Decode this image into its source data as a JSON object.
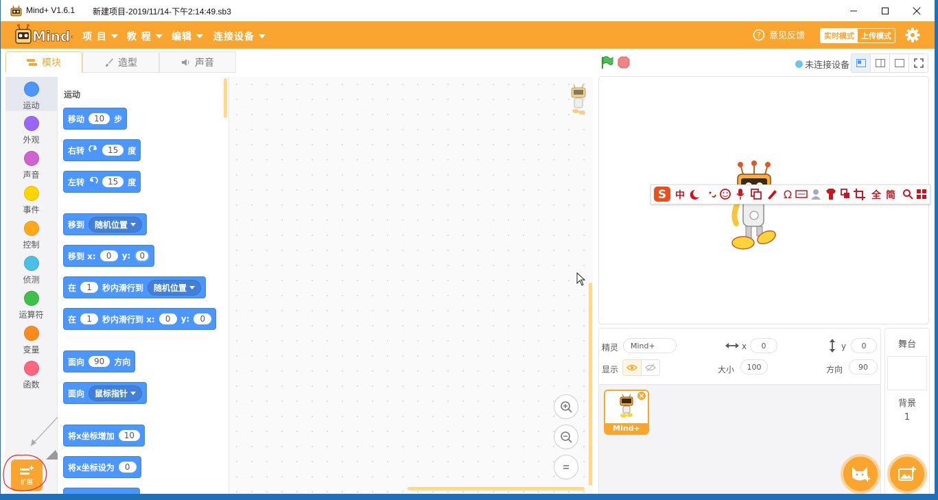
{
  "window": {
    "app_title": "Mind+ V1.6.1",
    "file_name": "新建项目-2019/11/14-下午2:14:49.sb3"
  },
  "menu": {
    "items": [
      {
        "label": "项 目"
      },
      {
        "label": "教 程"
      },
      {
        "label": "编辑"
      },
      {
        "label": "连接设备"
      }
    ],
    "feedback": "意见反馈",
    "mode_realtime": "实时模式",
    "mode_upload": "上传模式"
  },
  "tabs": [
    {
      "label": "模块"
    },
    {
      "label": "造型"
    },
    {
      "label": "声音"
    }
  ],
  "categories": [
    {
      "label": "运动",
      "color": "#4c97ff"
    },
    {
      "label": "外观",
      "color": "#9966ff"
    },
    {
      "label": "声音",
      "color": "#cf63cf"
    },
    {
      "label": "事件",
      "color": "#ffd500"
    },
    {
      "label": "控制",
      "color": "#ffab19"
    },
    {
      "label": "侦测",
      "color": "#4cbfe6"
    },
    {
      "label": "运算符",
      "color": "#40bf4a"
    },
    {
      "label": "变量",
      "color": "#ff8c1a"
    },
    {
      "label": "函数",
      "color": "#ff6680"
    }
  ],
  "extension_label": "扩展",
  "palette": {
    "section": "运动",
    "b1": {
      "a": "移动",
      "v": "10",
      "b": "步"
    },
    "b2": {
      "a": "右转",
      "v": "15",
      "b": "度"
    },
    "b3": {
      "a": "左转",
      "v": "15",
      "b": "度"
    },
    "b4": {
      "a": "移到",
      "dd": "随机位置"
    },
    "b5": {
      "a": "移到 x:",
      "x": "0",
      "y_label": "y:",
      "y": "0"
    },
    "b6": {
      "a": "在",
      "v": "1",
      "b": "秒内滑行到",
      "dd": "随机位置"
    },
    "b7": {
      "a": "在",
      "v": "1",
      "b": "秒内滑行到 x:",
      "x": "0",
      "y_label": "y:",
      "y": "0"
    },
    "b8": {
      "a": "面向",
      "v": "90",
      "b": "方向"
    },
    "b9": {
      "a": "面向",
      "dd": "鼠标指针"
    },
    "b10": {
      "a": "将x坐标增加",
      "v": "10"
    },
    "b11": {
      "a": "将x坐标设为",
      "v": "0"
    }
  },
  "stage_header": {
    "status": "未连接设备"
  },
  "sprite_info": {
    "sprite_label": "精灵",
    "sprite_name": "Mind+",
    "x_label": "x",
    "x": "0",
    "y_label": "y",
    "y": "0",
    "show_label": "显示",
    "size_label": "大小",
    "size": "100",
    "dir_label": "方向",
    "dir": "90"
  },
  "sprite_tile": {
    "name": "Mind+"
  },
  "stage_panel": {
    "title": "舞台",
    "backdrop_label": "背景",
    "backdrop_count": "1"
  },
  "ime_toolbar": {
    "chars": [
      "中",
      "全",
      "简"
    ]
  },
  "colors": {
    "accent": "#faa52f",
    "motion_block": "#4c97ff",
    "titlebar": "#ffffff",
    "border_blue": "#1e70b8"
  }
}
